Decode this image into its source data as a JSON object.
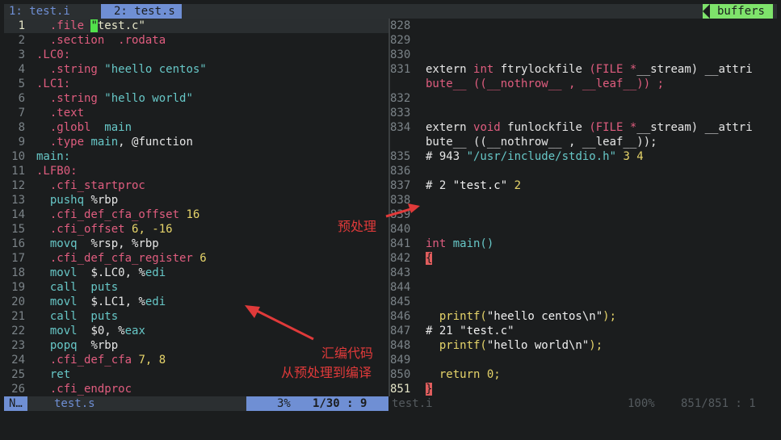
{
  "tabs": {
    "tab1": "1: test.i",
    "tab2": "2: test.s",
    "buffers": "buffers"
  },
  "left_lines": [
    {
      "n": "1",
      "segs": [
        [
          "  ",
          ""
        ],
        [
          ".file ",
          "kw"
        ],
        [
          "\"",
          "cur"
        ],
        [
          "test.c\"",
          "str"
        ]
      ]
    },
    {
      "n": "2",
      "segs": [
        [
          "  ",
          ""
        ],
        [
          ".section  .rodata",
          "kw"
        ]
      ]
    },
    {
      "n": "3",
      "segs": [
        [
          ".LC0:",
          "kw"
        ]
      ]
    },
    {
      "n": "4",
      "segs": [
        [
          "  ",
          ""
        ],
        [
          ".string ",
          "kw"
        ],
        [
          "\"heello centos\"",
          "fn"
        ]
      ]
    },
    {
      "n": "5",
      "segs": [
        [
          ".LC1:",
          "kw"
        ]
      ]
    },
    {
      "n": "6",
      "segs": [
        [
          "  ",
          ""
        ],
        [
          ".string ",
          "kw"
        ],
        [
          "\"hello world\"",
          "fn"
        ]
      ]
    },
    {
      "n": "7",
      "segs": [
        [
          "  ",
          ""
        ],
        [
          ".text",
          "kw"
        ]
      ]
    },
    {
      "n": "8",
      "segs": [
        [
          "  ",
          ""
        ],
        [
          ".globl  ",
          "kw"
        ],
        [
          "main",
          "fn"
        ]
      ]
    },
    {
      "n": "9",
      "segs": [
        [
          "  ",
          ""
        ],
        [
          ".type ",
          "kw"
        ],
        [
          "main",
          "fn"
        ],
        [
          ", @function",
          "plain"
        ]
      ]
    },
    {
      "n": "10",
      "segs": [
        [
          "main:",
          "fn"
        ]
      ]
    },
    {
      "n": "11",
      "segs": [
        [
          ".LFB0:",
          "kw"
        ]
      ]
    },
    {
      "n": "12",
      "segs": [
        [
          "  ",
          ""
        ],
        [
          ".cfi_startproc",
          "kw"
        ]
      ]
    },
    {
      "n": "13",
      "segs": [
        [
          "  ",
          ""
        ],
        [
          "pushq ",
          "fn"
        ],
        [
          "%rbp",
          "plain"
        ]
      ]
    },
    {
      "n": "14",
      "segs": [
        [
          "  ",
          ""
        ],
        [
          ".cfi_def_cfa_offset ",
          "kw"
        ],
        [
          "16",
          "num"
        ]
      ]
    },
    {
      "n": "15",
      "segs": [
        [
          "  ",
          ""
        ],
        [
          ".cfi_offset ",
          "kw"
        ],
        [
          "6, -16",
          "num"
        ]
      ]
    },
    {
      "n": "16",
      "segs": [
        [
          "  ",
          ""
        ],
        [
          "movq  ",
          "fn"
        ],
        [
          "%rsp, %rbp",
          "plain"
        ]
      ]
    },
    {
      "n": "17",
      "segs": [
        [
          "  ",
          ""
        ],
        [
          ".cfi_def_cfa_register ",
          "kw"
        ],
        [
          "6",
          "num"
        ]
      ]
    },
    {
      "n": "18",
      "segs": [
        [
          "  ",
          ""
        ],
        [
          "movl  ",
          "fn"
        ],
        [
          "$.LC0, %",
          "plain"
        ],
        [
          "edi",
          "fn"
        ]
      ]
    },
    {
      "n": "19",
      "segs": [
        [
          "  ",
          ""
        ],
        [
          "call  puts",
          "fn"
        ]
      ]
    },
    {
      "n": "20",
      "segs": [
        [
          "  ",
          ""
        ],
        [
          "movl  ",
          "fn"
        ],
        [
          "$.LC1, %",
          "plain"
        ],
        [
          "edi",
          "fn"
        ]
      ]
    },
    {
      "n": "21",
      "segs": [
        [
          "  ",
          ""
        ],
        [
          "call  puts",
          "fn"
        ]
      ]
    },
    {
      "n": "22",
      "segs": [
        [
          "  ",
          ""
        ],
        [
          "movl  ",
          "fn"
        ],
        [
          "$0, %",
          "plain"
        ],
        [
          "eax",
          "fn"
        ]
      ]
    },
    {
      "n": "23",
      "segs": [
        [
          "  ",
          ""
        ],
        [
          "popq  ",
          "fn"
        ],
        [
          "%rbp",
          "plain"
        ]
      ]
    },
    {
      "n": "24",
      "segs": [
        [
          "  ",
          ""
        ],
        [
          ".cfi_def_cfa ",
          "kw"
        ],
        [
          "7, 8",
          "num"
        ]
      ]
    },
    {
      "n": "25",
      "segs": [
        [
          "  ",
          ""
        ],
        [
          "ret",
          "fn"
        ]
      ]
    },
    {
      "n": "26",
      "segs": [
        [
          "  ",
          ""
        ],
        [
          ".cfi_endproc",
          "kw"
        ]
      ]
    }
  ],
  "right_lines": [
    {
      "n": "828",
      "segs": []
    },
    {
      "n": "829",
      "segs": []
    },
    {
      "n": "830",
      "segs": []
    },
    {
      "n": "831",
      "segs": [
        [
          "extern ",
          "plain"
        ],
        [
          "int ",
          "kw"
        ],
        [
          "ftrylockfile ",
          "plain"
        ],
        [
          "(FILE ",
          "kw"
        ],
        [
          "*",
          "kw"
        ],
        [
          "__stream) __attri",
          "plain"
        ]
      ]
    },
    {
      "n": "",
      "segs": [
        [
          "bute__ ((__nothrow__ , __leaf__)) ;",
          "kw"
        ]
      ]
    },
    {
      "n": "832",
      "segs": []
    },
    {
      "n": "833",
      "segs": []
    },
    {
      "n": "834",
      "segs": [
        [
          "extern ",
          "plain"
        ],
        [
          "void ",
          "kw"
        ],
        [
          "funlockfile ",
          "plain"
        ],
        [
          "(FILE ",
          "kw"
        ],
        [
          "*",
          "kw"
        ],
        [
          "__stream) __attri",
          "plain"
        ]
      ]
    },
    {
      "n": "",
      "segs": [
        [
          "bute__ ((__nothrow__ , __leaf__));",
          "plain"
        ]
      ]
    },
    {
      "n": "835",
      "segs": [
        [
          "# 943 ",
          "plain"
        ],
        [
          "\"/usr/include/stdio.h\"",
          "fn"
        ],
        [
          " 3 4",
          "num"
        ]
      ]
    },
    {
      "n": "836",
      "segs": []
    },
    {
      "n": "837",
      "segs": [
        [
          "# 2 ",
          "plain"
        ],
        [
          "\"test.c\"",
          "white"
        ],
        [
          " 2",
          "num"
        ]
      ]
    },
    {
      "n": "838",
      "segs": []
    },
    {
      "n": "839",
      "segs": []
    },
    {
      "n": "840",
      "segs": []
    },
    {
      "n": "841",
      "segs": [
        [
          "int ",
          "kw"
        ],
        [
          "main()",
          "fn"
        ]
      ]
    },
    {
      "n": "842",
      "segs": [
        [
          "{",
          "cur2"
        ]
      ]
    },
    {
      "n": "843",
      "segs": []
    },
    {
      "n": "844",
      "segs": []
    },
    {
      "n": "845",
      "segs": []
    },
    {
      "n": "846",
      "segs": [
        [
          "  printf(",
          "num"
        ],
        [
          "\"heello centos\\n\"",
          "white"
        ],
        [
          ");",
          "num"
        ]
      ]
    },
    {
      "n": "847",
      "segs": [
        [
          "# 21 ",
          "plain"
        ],
        [
          "\"test.c\"",
          "white"
        ]
      ]
    },
    {
      "n": "848",
      "segs": [
        [
          "  printf(",
          "num"
        ],
        [
          "\"hello world\\n\"",
          "white"
        ],
        [
          ");",
          "num"
        ]
      ]
    },
    {
      "n": "849",
      "segs": []
    },
    {
      "n": "850",
      "segs": [
        [
          "  return ",
          "num"
        ],
        [
          "0",
          "num"
        ],
        [
          ";",
          "num"
        ]
      ]
    },
    {
      "n": "851",
      "segs": [
        [
          "}",
          "cur2"
        ]
      ]
    }
  ],
  "status_left": {
    "mode": "N…",
    "file": "test.s",
    "percent": "3%",
    "position": "1/30 :  9"
  },
  "status_right": {
    "file": "test.i",
    "percent": "100%",
    "position": "851/851 :  1"
  },
  "annotations": {
    "preprocess": "预处理",
    "line1": "汇编代码",
    "line2": "从预处理到编译"
  },
  "colors": {
    "accent": "#6f8fd4",
    "buffers": "#7ee36b",
    "keyword": "#e05d7f",
    "arrow": "#e03a3a"
  }
}
